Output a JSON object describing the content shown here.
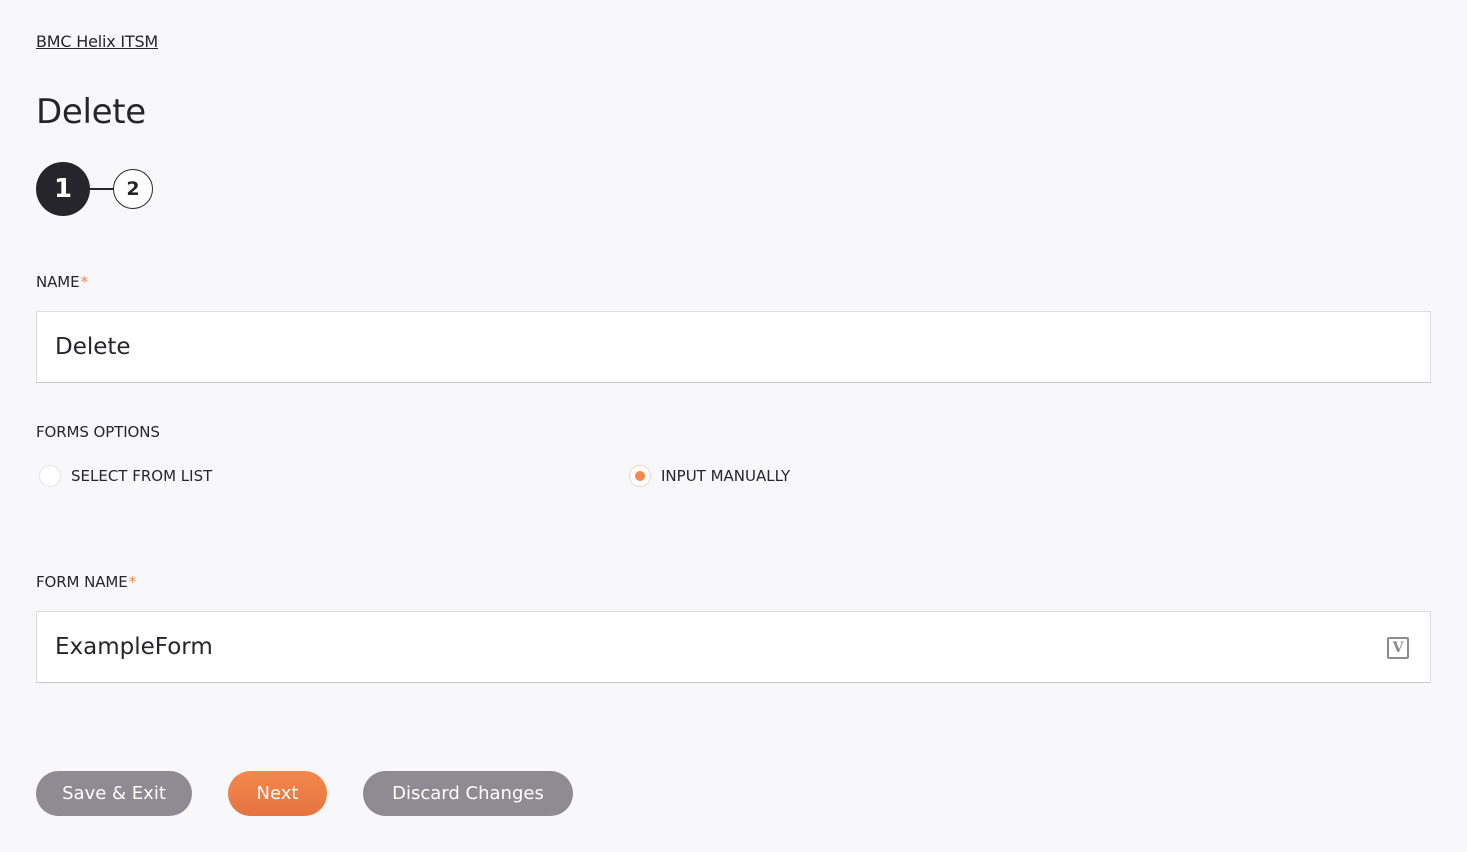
{
  "breadcrumb": "BMC Helix ITSM",
  "title": "Delete",
  "stepper": {
    "steps": [
      {
        "label": "1",
        "active": true
      },
      {
        "label": "2",
        "active": false
      }
    ]
  },
  "name_field": {
    "label": "NAME",
    "required_mark": "*",
    "value": "Delete"
  },
  "forms_options": {
    "label": "FORMS OPTIONS",
    "options": [
      {
        "label": "SELECT FROM LIST",
        "selected": false
      },
      {
        "label": "INPUT MANUALLY",
        "selected": true
      }
    ]
  },
  "form_name_field": {
    "label": "FORM NAME",
    "required_mark": "*",
    "value": "ExampleForm",
    "icon": "variable-icon",
    "icon_glyph": "V"
  },
  "actions": {
    "save_exit": "Save & Exit",
    "next": "Next",
    "discard": "Discard Changes"
  },
  "colors": {
    "accent": "#f4874b",
    "dark": "#26252c",
    "secondary_button": "#8f8b93",
    "background": "#f8f8fa"
  }
}
